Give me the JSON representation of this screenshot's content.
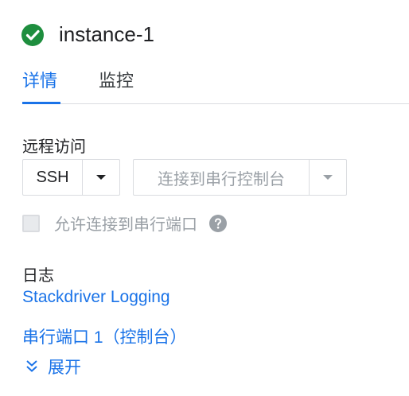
{
  "instance": {
    "name": "instance-1",
    "status_icon": "check-circle-icon",
    "status_color": "#1e8e3e"
  },
  "tabs": [
    {
      "label": "详情",
      "active": true
    },
    {
      "label": "监控",
      "active": false
    }
  ],
  "remote_access": {
    "label": "远程访问",
    "ssh_label": "SSH",
    "serial_connect_label": "连接到串行控制台",
    "allow_serial_label": "允许连接到串行端口",
    "allow_serial_checked": false
  },
  "logs": {
    "label": "日志",
    "stackdriver_link": "Stackdriver Logging",
    "serial_port_link": "串行端口 1（控制台）",
    "expand_label": "展开"
  },
  "colors": {
    "accent": "#1a73e8",
    "disabled_text": "#9aa0a6",
    "border": "#dadce0"
  }
}
